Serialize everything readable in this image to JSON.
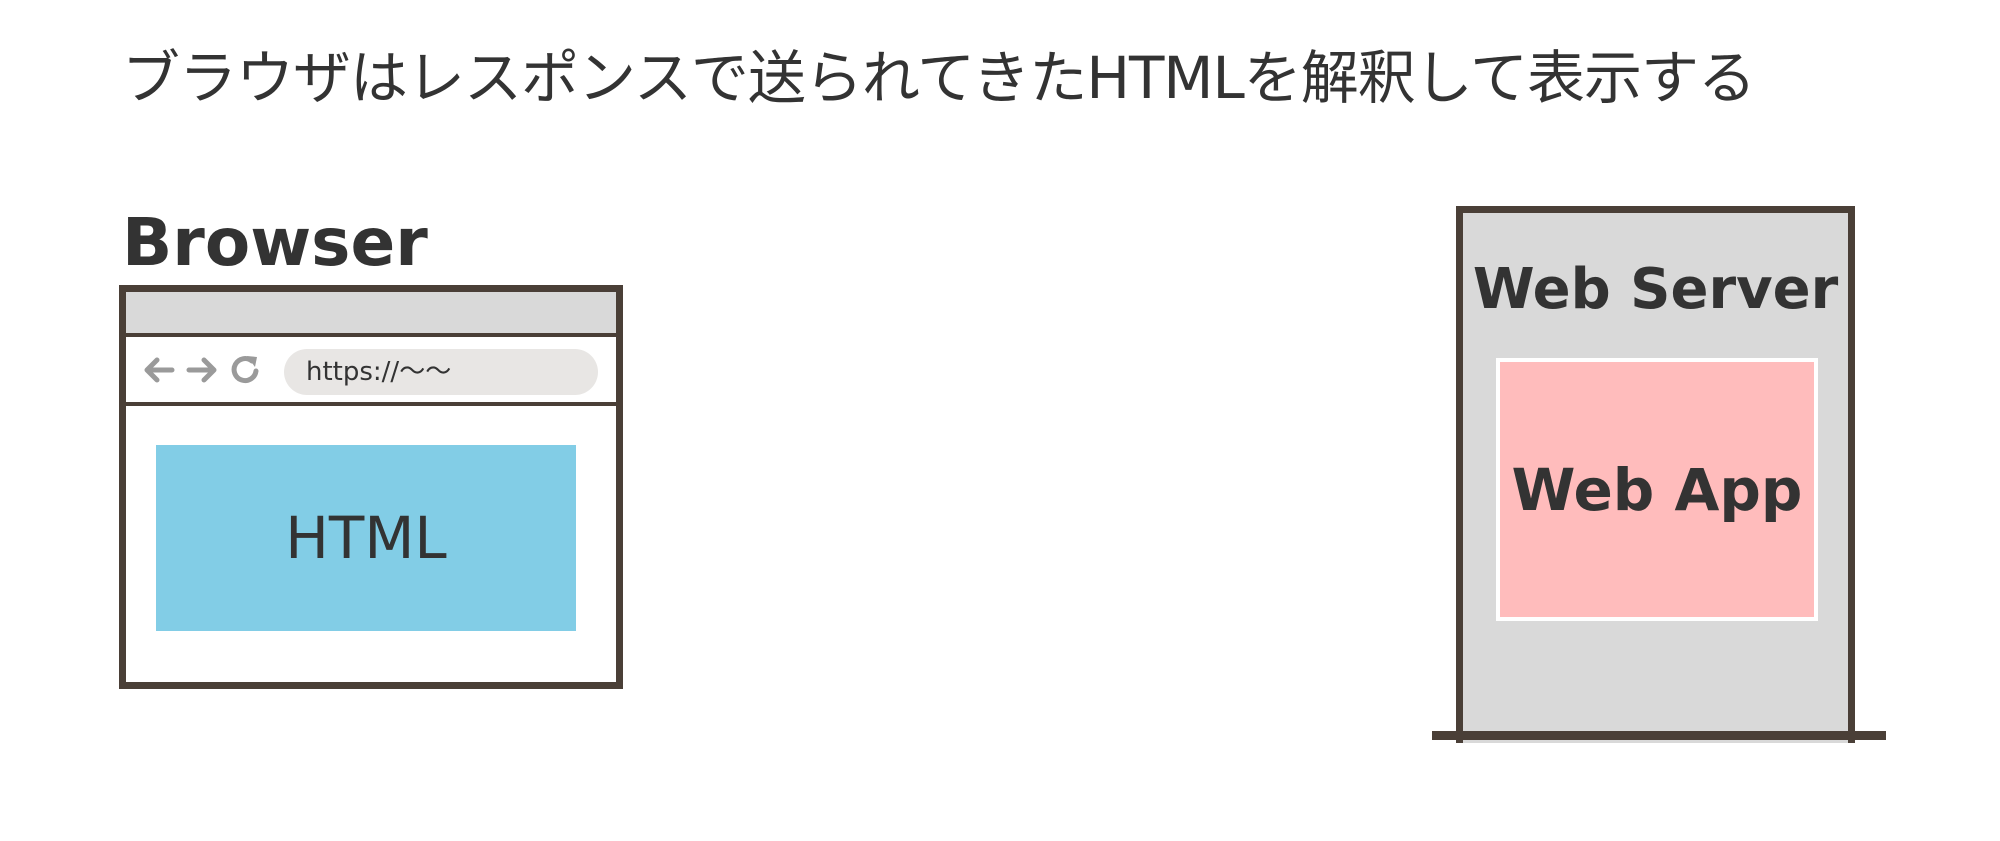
{
  "title": "ブラウザはレスポンスで送られてきたHTMLを解釈して表示する",
  "browser": {
    "label": "Browser",
    "address": "https://〜〜",
    "content_label": "HTML",
    "icons": [
      "back-arrow-icon",
      "forward-arrow-icon",
      "reload-icon"
    ]
  },
  "server": {
    "label": "Web Server",
    "app_label": "Web App"
  },
  "colors": {
    "frame": "#4a3f37",
    "html_block": "#82cde6",
    "web_app_block": "#ffbcbc",
    "server_fill": "#d9d9d9",
    "address_bar": "#e8e6e4"
  }
}
